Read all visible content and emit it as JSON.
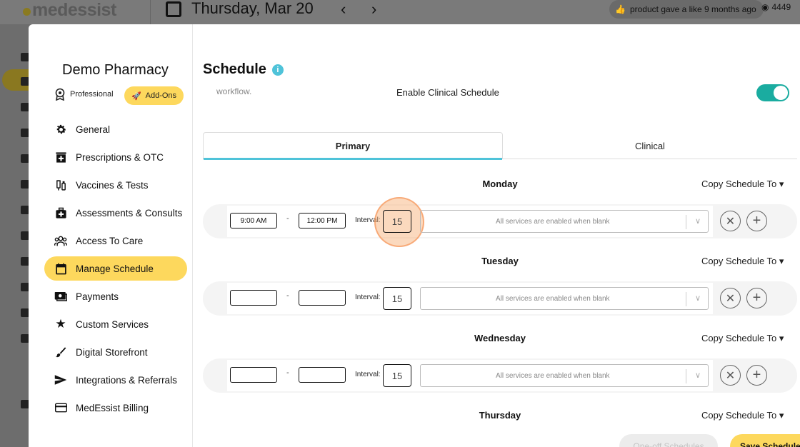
{
  "background": {
    "logo": "medessist",
    "date": "Thursday, Mar 20",
    "activity": "product gave a like 9 months ago",
    "views": "4449"
  },
  "sidebar": {
    "pharmacy_name": "Demo Pharmacy",
    "plan": "Professional",
    "addons": "Add-Ons",
    "items": [
      {
        "label": "General",
        "icon": "gear-icon"
      },
      {
        "label": "Prescriptions & OTC",
        "icon": "pharmacy-icon"
      },
      {
        "label": "Vaccines & Tests",
        "icon": "syringe-icon"
      },
      {
        "label": "Assessments & Consults",
        "icon": "medkit-icon"
      },
      {
        "label": "Access To Care",
        "icon": "people-icon"
      },
      {
        "label": "Manage Schedule",
        "icon": "calendar-icon",
        "active": true
      },
      {
        "label": "Payments",
        "icon": "payment-icon"
      },
      {
        "label": "Custom Services",
        "icon": "star-icon"
      },
      {
        "label": "Digital Storefront",
        "icon": "brush-icon"
      },
      {
        "label": "Integrations & Referrals",
        "icon": "send-icon"
      },
      {
        "label": "MedEssist Billing",
        "icon": "card-icon"
      }
    ]
  },
  "main": {
    "title": "Schedule",
    "workflow_text": "workflow.",
    "clinical_toggle_label": "Enable Clinical Schedule",
    "clinical_toggle_on": true,
    "tabs": [
      "Primary",
      "Clinical"
    ],
    "active_tab": "Primary",
    "interval_label": "Interval:",
    "services_placeholder": "All services are enabled when blank",
    "copy_label": "Copy Schedule To",
    "days": [
      {
        "name": "Monday",
        "start": "9:00 AM",
        "end": "12:00 PM",
        "interval": "15"
      },
      {
        "name": "Tuesday",
        "start": "",
        "end": "",
        "interval": "15"
      },
      {
        "name": "Wednesday",
        "start": "",
        "end": "",
        "interval": "15"
      },
      {
        "name": "Thursday"
      }
    ],
    "footer": {
      "oneoff": "One-off Schedules",
      "save": "Save Schedule"
    }
  },
  "colors": {
    "accent_yellow": "#fdd85d",
    "tab_underline": "#4fc3d9",
    "toggle_on": "#1aaca0"
  }
}
